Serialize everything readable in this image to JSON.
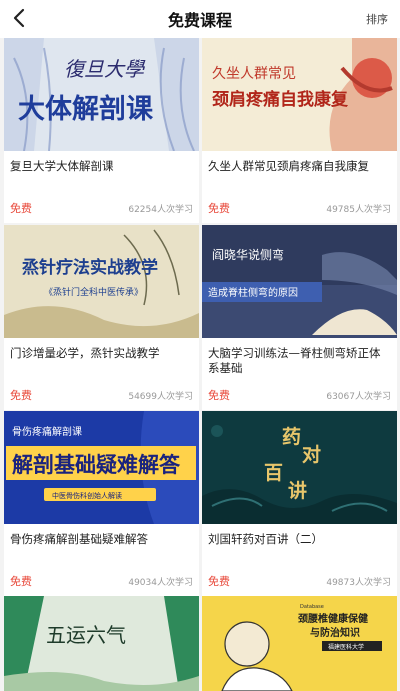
{
  "header": {
    "title": "免费课程",
    "sort_label": "排序"
  },
  "courses": [
    {
      "thumb_text": [
        "復旦大學",
        "大体解剖课"
      ],
      "title": "复旦大学大体解剖课",
      "price": "免费",
      "learners": "62254人次学习"
    },
    {
      "thumb_text": [
        "久坐人群常见",
        "颈肩疼痛自我康复"
      ],
      "title": "久坐人群常见颈肩疼痛自我康复",
      "price": "免费",
      "learners": "49785人次学习"
    },
    {
      "thumb_text": [
        "烝针疗法实战教学",
        "《烝针门全科中医传承》"
      ],
      "title": "门诊增量必学，烝针实战教学",
      "price": "免费",
      "learners": "54699人次学习"
    },
    {
      "thumb_text": [
        "阎晓华说侧弯",
        "造成脊柱侧弯的原因"
      ],
      "title": "大脑学习训练法—脊柱侧弯矫正体系基础",
      "price": "免费",
      "learners": "63067人次学习"
    },
    {
      "thumb_text": [
        "骨伤疼痛解剖课",
        "解剖基础疑难解答",
        "中医骨伤科创始人解读"
      ],
      "title": "骨伤疼痛解剖基础疑难解答",
      "price": "免费",
      "learners": "49034人次学习"
    },
    {
      "thumb_text": [
        "药",
        "对",
        "百",
        "讲"
      ],
      "title": "刘国轩药对百讲（二）",
      "price": "免费",
      "learners": "49873人次学习"
    },
    {
      "thumb_text": [
        "五运六气"
      ]
    },
    {
      "thumb_text": [
        "Database",
        "颈腰椎健康保健",
        "与防治知识",
        "福建医科大学"
      ]
    }
  ],
  "colors": {
    "price": "#e8483a",
    "count": "#999999"
  }
}
